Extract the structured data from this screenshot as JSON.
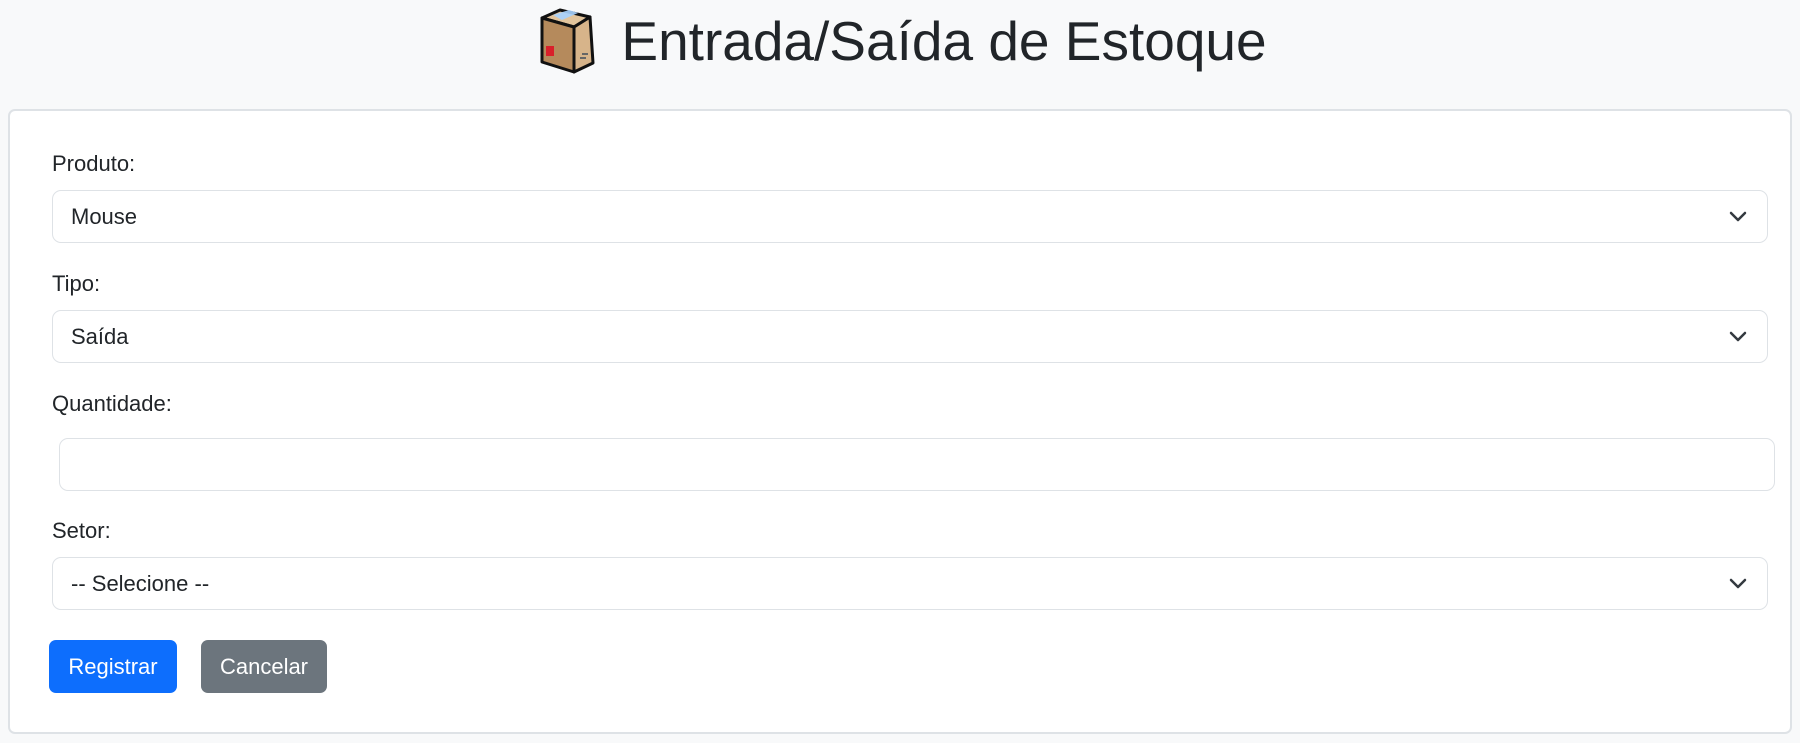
{
  "header": {
    "icon": "package-box-icon",
    "title": "Entrada/Saída de Estoque"
  },
  "form": {
    "produto": {
      "label": "Produto:",
      "value": "Mouse"
    },
    "tipo": {
      "label": "Tipo:",
      "value": "Saída"
    },
    "quantidade": {
      "label": "Quantidade:",
      "value": ""
    },
    "setor": {
      "label": "Setor:",
      "value": "-- Selecione --"
    }
  },
  "actions": {
    "submit_label": "Registrar",
    "cancel_label": "Cancelar"
  },
  "colors": {
    "page_background": "#f8f9fa",
    "primary_button": "#0d6efd",
    "secondary_button": "#6c757d",
    "border": "#dee2e6"
  }
}
